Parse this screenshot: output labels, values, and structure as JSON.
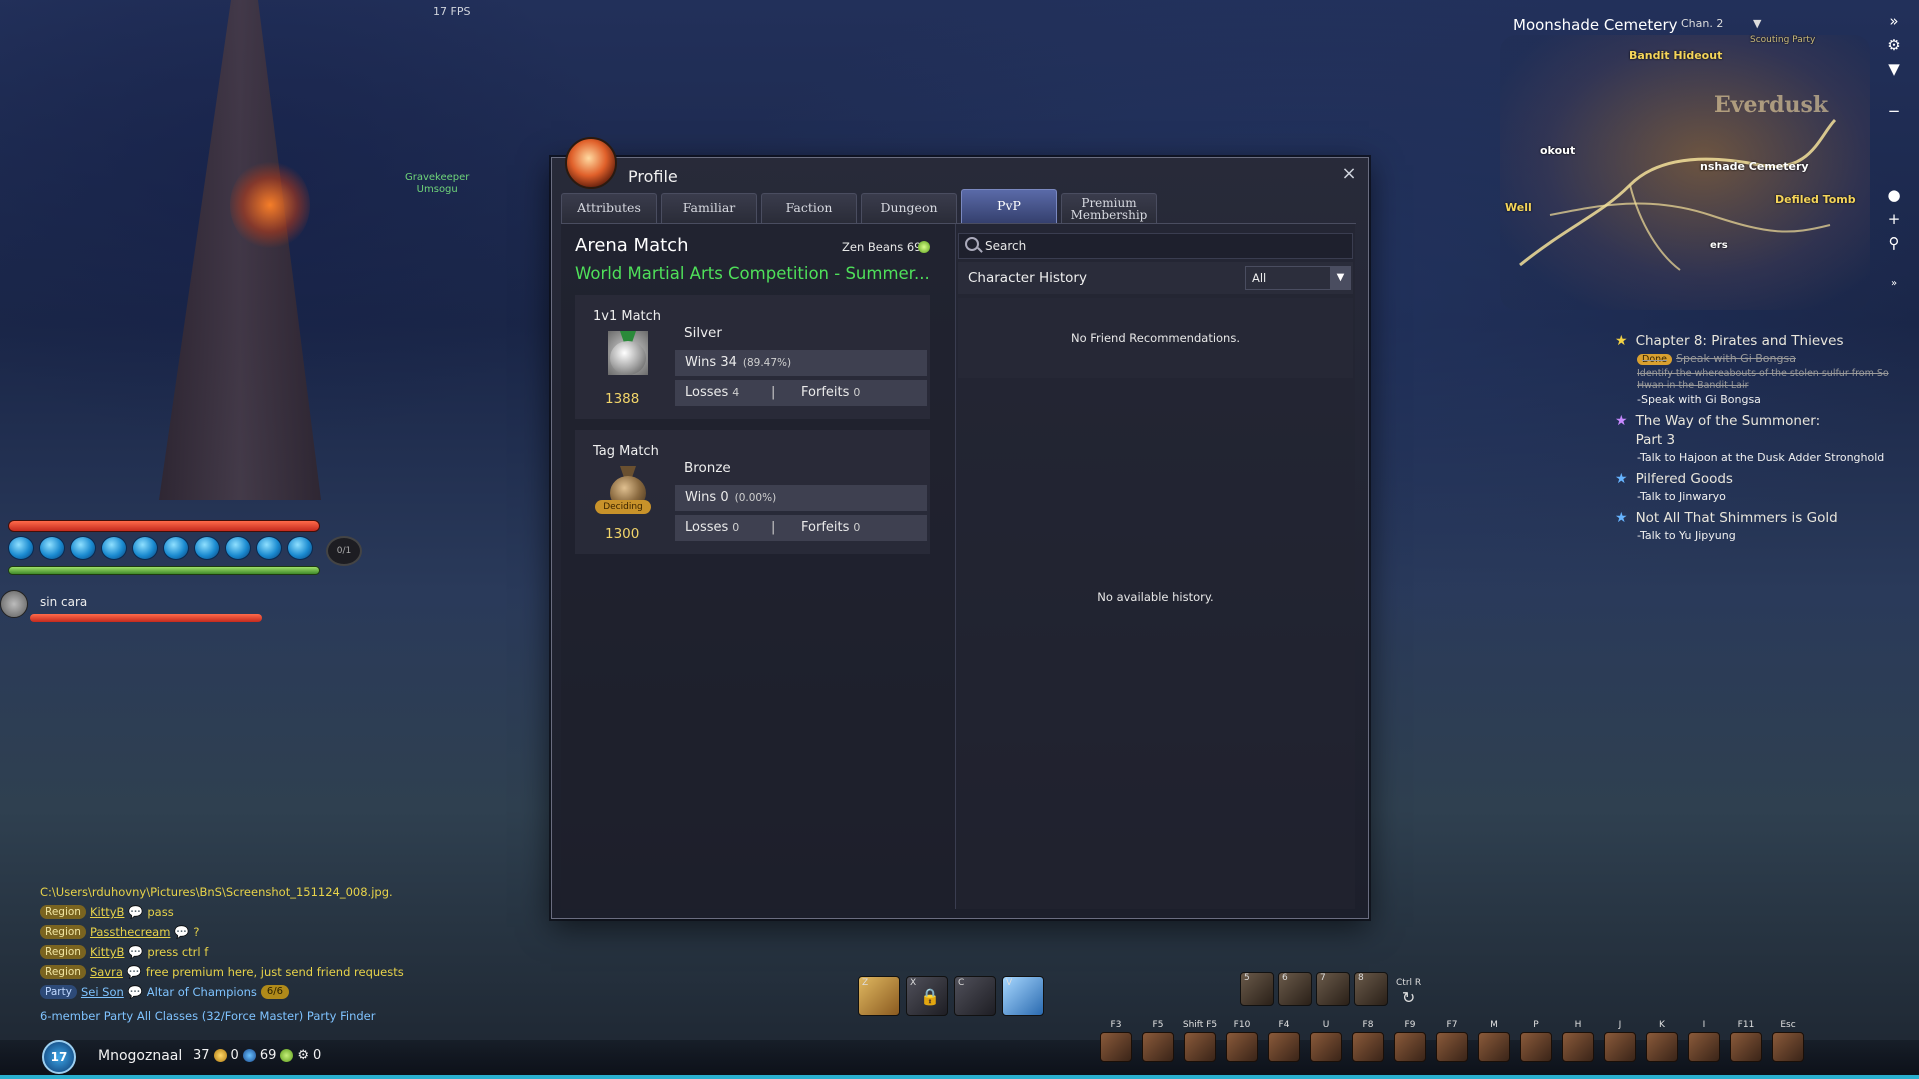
{
  "hud": {
    "fps": "17 FPS",
    "npc_name": "Gravekeeper\nUmsogu",
    "orb_counter": "0/1",
    "pet_name": "sin cara",
    "character_name": "Mnogoznaal",
    "level": "17",
    "gold": "37",
    "silver": "0",
    "zen": "69",
    "misc": "0"
  },
  "minimap": {
    "zone": "Moonshade Cemetery",
    "channel": "Chan. 2",
    "labels": {
      "bandit_hideout": "Bandit Hideout",
      "everdusk": "Everdusk",
      "lookout": "okout",
      "moonshade": "nshade Cemetery",
      "defiled_tomb": "Defiled Tomb",
      "well": "Well",
      "scouting": "Scouting Party",
      "fires": "ers"
    }
  },
  "quests": [
    {
      "title": "Chapter 8: Pirates and Thieves",
      "icon": "gold-star",
      "steps": [
        {
          "pill": "Done",
          "text": "Speak with Gi Bongsa",
          "done": true
        },
        {
          "text": "Identify the whereabouts of the stolen sulfur from So Hwan in the Bandit Lair",
          "done": true
        },
        {
          "text": "-Speak with Gi Bongsa",
          "done": false
        }
      ]
    },
    {
      "title": "The Way of the Summoner: Part 3",
      "icon": "purple-star",
      "steps": [
        {
          "text": "-Talk to Hajoon at the Dusk Adder Stronghold",
          "done": false
        }
      ]
    },
    {
      "title": "Pilfered Goods",
      "icon": "blue-star",
      "steps": [
        {
          "text": "-Talk to Jinwaryo",
          "done": false
        }
      ]
    },
    {
      "title": "Not All That Shimmers is Gold",
      "icon": "blue-star",
      "steps": [
        {
          "text": "-Talk to Yu Jipyung",
          "done": false
        }
      ]
    }
  ],
  "chat": {
    "path": "C:\\Users\\rduhovny\\Pictures\\BnS\\Screenshot_151124_008.jpg.",
    "lines": [
      {
        "tag": "Region",
        "name": "KittyB",
        "msg": "pass"
      },
      {
        "tag": "Region",
        "name": "Passthecream",
        "msg": "?"
      },
      {
        "tag": "Region",
        "name": "KittyB",
        "msg": "press ctrl f"
      },
      {
        "tag": "Region",
        "name": "Savra",
        "msg": "free premium here, just send friend requests"
      }
    ],
    "party_line": {
      "tag": "Party",
      "name": "Sei Son",
      "msg": "Altar of Champions",
      "count": "6/6",
      "rest": "6-member Party All Classes (32/Force Master) Party Finder"
    }
  },
  "hotkeys": [
    "F3",
    "F5",
    "Shift F5",
    "F10",
    "F4",
    "U",
    "F8",
    "F9",
    "F7",
    "M",
    "P",
    "H",
    "J",
    "K",
    "I",
    "F11",
    "Esc"
  ],
  "skills": [
    "Z",
    "X",
    "C",
    "V"
  ],
  "skills2": [
    "5",
    "6",
    "7",
    "8"
  ],
  "ctrl_r": "Ctrl R",
  "profile": {
    "title": "Profile",
    "close": "×",
    "tabs": [
      "Attributes",
      "Familiar",
      "Faction",
      "Dungeon",
      "PvP",
      "Premium Membership"
    ],
    "active_tab": "PvP",
    "arena_title": "Arena Match",
    "zen_beans_label": "Zen Beans",
    "zen_beans_value": "69",
    "season": "World Martial Arts Competition - Summer...",
    "matches": [
      {
        "name": "1v1 Match",
        "tier": "Silver",
        "rating": "1388",
        "wins_label": "Wins",
        "wins": "34",
        "pct": "(89.47%)",
        "losses_label": "Losses",
        "losses": "4",
        "forfeits_label": "Forfeits",
        "forfeits": "0",
        "deciding": ""
      },
      {
        "name": "Tag Match",
        "tier": "Bronze",
        "rating": "1300",
        "wins_label": "Wins",
        "wins": "0",
        "pct": "(0.00%)",
        "losses_label": "Losses",
        "losses": "0",
        "forfeits_label": "Forfeits",
        "forfeits": "0",
        "deciding": "Deciding"
      }
    ],
    "search_placeholder": "Search",
    "history_label": "Character History",
    "filter_value": "All",
    "no_friends": "No Friend Recommendations.",
    "no_history": "No available history."
  }
}
